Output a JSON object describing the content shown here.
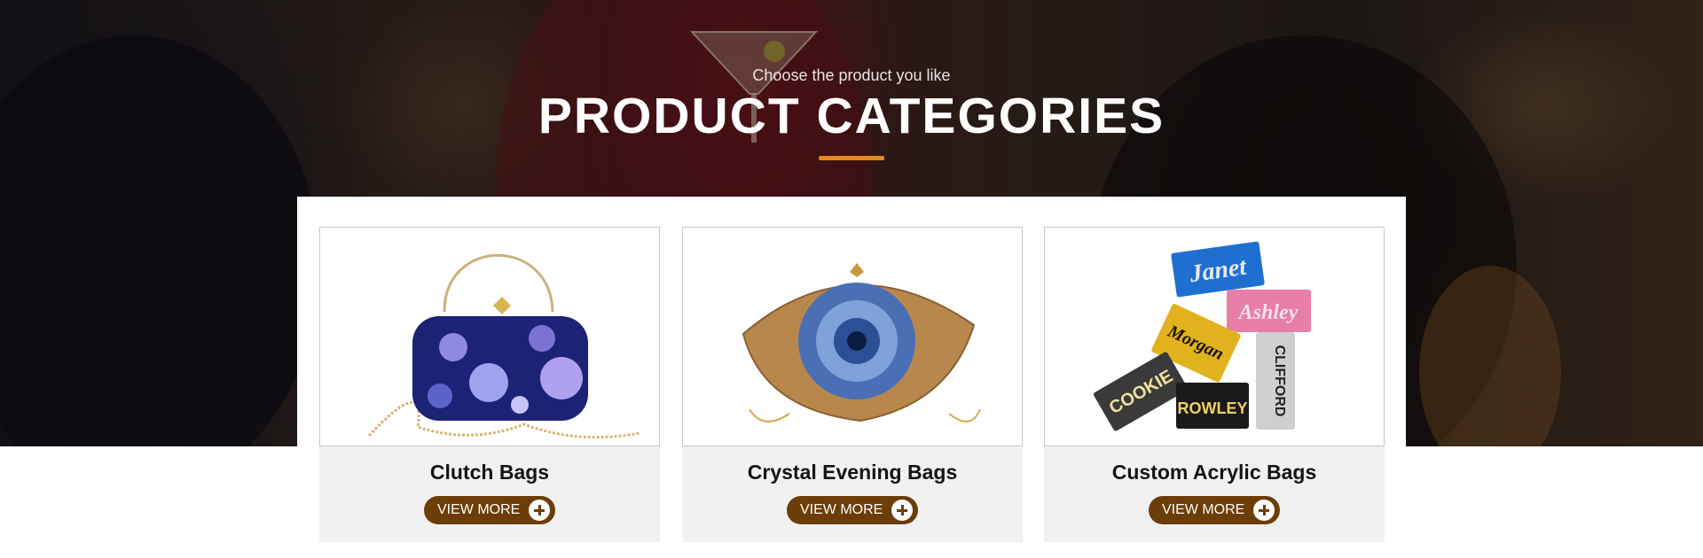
{
  "header": {
    "subtitle": "Choose the product you like",
    "title": "PRODUCT CATEGORIES"
  },
  "colors": {
    "accent_underline": "#e48a1e",
    "button_bg": "#6c3d06",
    "card_footer_bg": "#f1f1f1"
  },
  "categories": [
    {
      "name": "Clutch Bags",
      "button_label": "VIEW MORE",
      "image_icon": "floral-clutch-bag-image"
    },
    {
      "name": "Crystal Evening Bags",
      "button_label": "VIEW MORE",
      "image_icon": "crystal-eye-bag-image"
    },
    {
      "name": "Custom Acrylic Bags",
      "button_label": "VIEW MORE",
      "image_icon": "acrylic-name-bags-image"
    }
  ],
  "acrylic_bag_names": [
    "Janet",
    "Ashley",
    "Morgan",
    "COOKIE",
    "ROWLEY",
    "CLIFFORD"
  ]
}
